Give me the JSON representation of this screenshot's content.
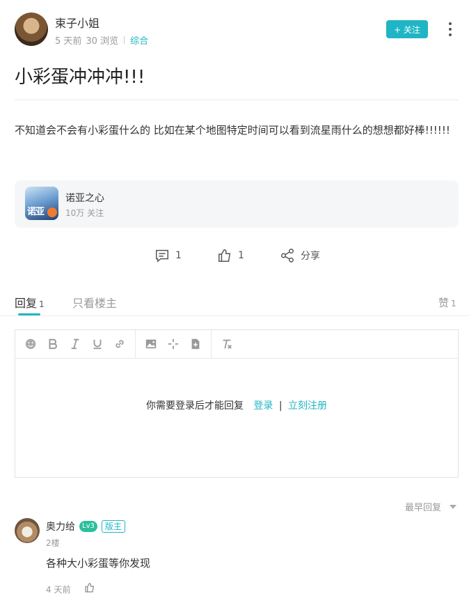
{
  "post": {
    "author": {
      "name": "束子小姐",
      "avatar_icon": "author-avatar"
    },
    "meta": {
      "time": "5 天前",
      "views": "30 浏览",
      "category": "综合"
    },
    "follow_label": "+ 关注",
    "title": "小彩蛋冲冲冲!!!",
    "content": "不知道会不会有小彩蛋什么的 比如在某个地图特定时间可以看到流星雨什么的想想都好棒!!!!!!"
  },
  "game": {
    "name": "诺亚之心",
    "followers": "10万 关注",
    "icon_text": "诺亚"
  },
  "actions": {
    "comments": "1",
    "likes": "1",
    "share": "分享"
  },
  "tabs": {
    "reply_label": "回复",
    "reply_count": "1",
    "owner_only": "只看楼主",
    "likes_label": "赞",
    "likes_count": "1"
  },
  "editor": {
    "login_prompt": "你需要登录后才能回复",
    "login_link": "登录",
    "separator": "|",
    "register_link": "立刻注册",
    "toolbar_icons": [
      "emoji-icon",
      "bold-icon",
      "italic-icon",
      "underline-icon",
      "link-icon",
      "image-icon",
      "move-icon",
      "attachment-icon",
      "clear-format-icon"
    ]
  },
  "sort": {
    "label": "最早回复"
  },
  "comments": [
    {
      "name": "奥力给",
      "level": "Lv3",
      "role": "版主",
      "floor": "2楼",
      "text": "各种大小彩蛋等你发现",
      "time": "4 天前"
    }
  ],
  "colors": {
    "accent": "#1fb5c4",
    "level_badge": "#2bbf9c"
  }
}
